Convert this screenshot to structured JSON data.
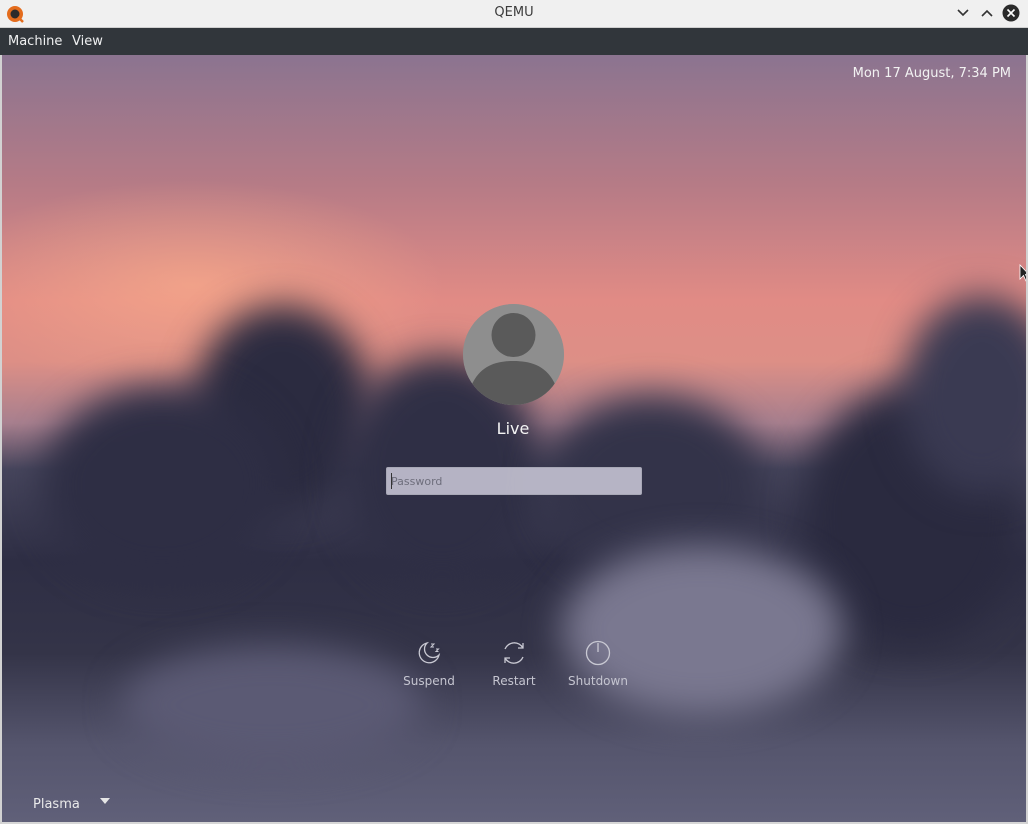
{
  "window": {
    "title": "QEMU",
    "icons": {
      "app": "qemu-logo-icon",
      "minimize": "chevron-down-icon",
      "maximize": "chevron-up-icon",
      "close": "close-circle-icon"
    }
  },
  "menubar": {
    "items": [
      "Machine",
      "View"
    ]
  },
  "lockscreen": {
    "clock": "Mon 17 August,  7:34 PM",
    "user": {
      "name": "Live",
      "avatar_icon": "user-avatar-icon"
    },
    "password": {
      "value": "",
      "placeholder": "Password"
    },
    "actions": [
      {
        "label": "Suspend",
        "icon": "suspend-icon"
      },
      {
        "label": "Restart",
        "icon": "restart-icon"
      },
      {
        "label": "Shutdown",
        "icon": "shutdown-icon"
      }
    ],
    "session": {
      "selected": "Plasma",
      "icon": "dropdown-arrow-icon"
    }
  },
  "colors": {
    "titlebar_bg": "#f0f0f0",
    "menubar_bg": "#31363b",
    "sunset": "#e18b85",
    "dusk": "#2e2e44"
  }
}
